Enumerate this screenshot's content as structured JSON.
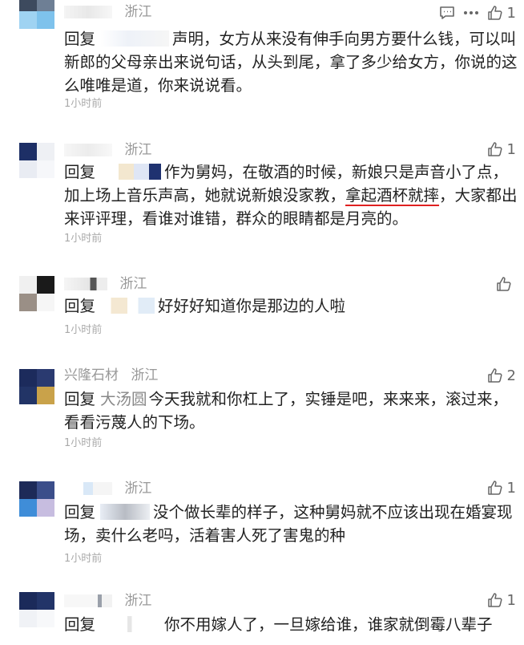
{
  "comments": [
    {
      "nick": "",
      "location": "浙江",
      "likes": "1",
      "reply_label": "回复",
      "target": "",
      "text": "声明，女方从来没有伸手向男方要什么钱，可以叫新郎的父母亲出来说句话，从头到尾，拿了多少给女方，你说的这么唯唯是道，你来说说看。",
      "time": "1小时前"
    },
    {
      "nick": "",
      "location": "浙江",
      "likes": "1",
      "reply_label": "回复",
      "target": "",
      "text_before": "作为舅妈，在敬酒的时候，新娘只是声音小了点，加上场上音乐声高，她就说新娘没家教，",
      "text_highlight": "拿起酒杯就摔",
      "text_after": "，大家都出来评评理，看谁对谁错，群众的眼睛都是月亮的。",
      "time": "1小时前"
    },
    {
      "nick": "",
      "location": "浙江",
      "likes": "",
      "reply_label": "回复",
      "target": "",
      "text": "好好好知道你是那边的人啦",
      "time": "1小时前"
    },
    {
      "nick": "兴隆石材",
      "location": "浙江",
      "likes": "2",
      "reply_label": "回复",
      "target": "大汤圆",
      "text": "今天我就和你杠上了，实锤是吧，来来来，滚过来，看看污蔑人的下场。",
      "time": "1小时前"
    },
    {
      "nick": "",
      "location": "浙江",
      "likes": "1",
      "reply_label": "回复",
      "target": "",
      "text": "没个做长辈的样子，这种舅妈就不应该出现在婚宴现场，卖什么老吗，活着害人死了害鬼的种",
      "time": "1小时前"
    },
    {
      "nick": "",
      "location": "浙江",
      "likes": "1",
      "reply_label": "回复",
      "target": "",
      "text": "你不用嫁人了，一旦嫁给谁，谁家就倒霉八辈子",
      "time": ""
    }
  ],
  "colors": {
    "meta": "#999999",
    "text": "#222222",
    "underline": "#e02020"
  }
}
